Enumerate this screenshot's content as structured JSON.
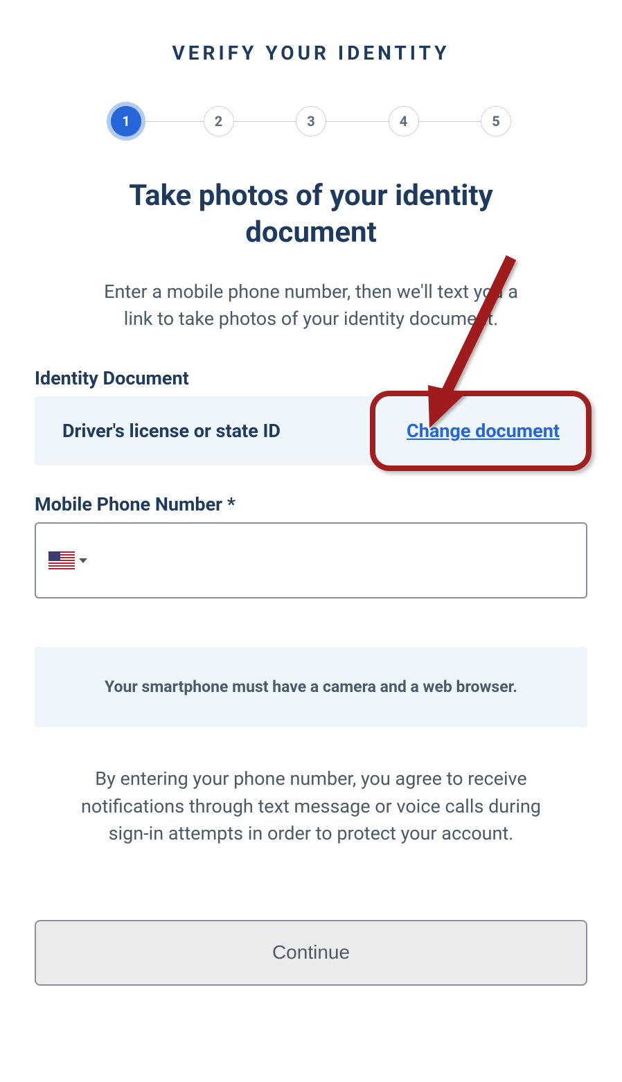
{
  "title": "VERIFY YOUR IDENTITY",
  "steps": {
    "labels": [
      "1",
      "2",
      "3",
      "4",
      "5"
    ],
    "active": 1
  },
  "heading": "Take photos of your identity document",
  "description": "Enter a mobile phone number, then we'll text you a link to take photos of your identity document.",
  "identity": {
    "label": "Identity Document",
    "value": "Driver's license or state ID",
    "change_link": "Change document"
  },
  "phone": {
    "label": "Mobile Phone Number *",
    "country": "US"
  },
  "info_notice": "Your smartphone must have a camera and a web browser.",
  "agreement": "By entering your phone number, you agree to receive notifications through text message or voice calls during sign-in attempts in order to protect your account.",
  "continue_label": "Continue"
}
